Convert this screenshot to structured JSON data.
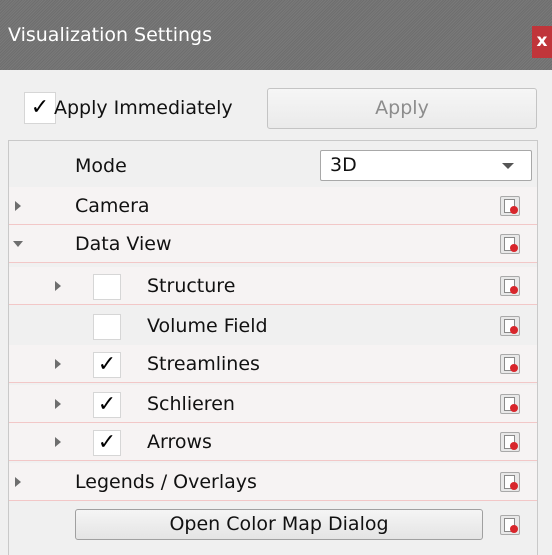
{
  "window": {
    "title": "Visualization Settings",
    "close_label": "x"
  },
  "apply_row": {
    "apply_immediately_label": "Apply Immediately",
    "apply_immediately_checked": true,
    "apply_button_label": "Apply",
    "apply_button_enabled": false
  },
  "check_mark": "✓",
  "tree": {
    "mode": {
      "label": "Mode",
      "value": "3D"
    },
    "camera": {
      "label": "Camera",
      "expanded": false
    },
    "data_view": {
      "label": "Data View",
      "expanded": true,
      "items": [
        {
          "label": "Structure",
          "checked": false,
          "expandable": true
        },
        {
          "label": "Volume Field",
          "checked": false,
          "expandable": false
        },
        {
          "label": "Streamlines",
          "checked": true,
          "expandable": true
        },
        {
          "label": "Schlieren",
          "checked": true,
          "expandable": true
        },
        {
          "label": "Arrows",
          "checked": true,
          "expandable": true
        }
      ]
    },
    "legends": {
      "label": "Legends / Overlays",
      "expanded": false
    },
    "color_map_button_label": "Open Color Map Dialog"
  },
  "colors": {
    "title_bar": "#727272",
    "close_button": "#c0353a",
    "row_separator": "#f2c7c7",
    "reset_dot": "#d8262c"
  },
  "icons": {
    "reset": "reset-to-default-icon",
    "expand": "chevron-right-icon",
    "collapse": "chevron-down-icon"
  }
}
